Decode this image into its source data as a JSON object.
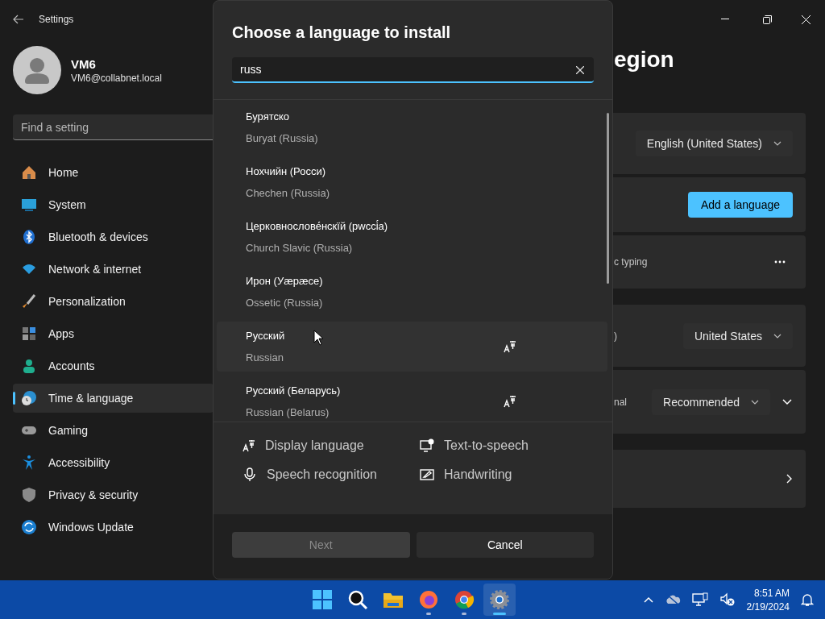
{
  "window": {
    "title": "Settings"
  },
  "account": {
    "name": "VM6",
    "email": "VM6@collabnet.local"
  },
  "search": {
    "placeholder": "Find a setting"
  },
  "sidebar": {
    "items": [
      {
        "label": "Home",
        "kind": "home",
        "selected": false
      },
      {
        "label": "System",
        "kind": "system",
        "selected": false
      },
      {
        "label": "Bluetooth & devices",
        "kind": "bluetooth",
        "selected": false
      },
      {
        "label": "Network & internet",
        "kind": "network",
        "selected": false
      },
      {
        "label": "Personalization",
        "kind": "brush",
        "selected": false
      },
      {
        "label": "Apps",
        "kind": "apps",
        "selected": false
      },
      {
        "label": "Accounts",
        "kind": "accounts",
        "selected": false
      },
      {
        "label": "Time & language",
        "kind": "time",
        "selected": true
      },
      {
        "label": "Gaming",
        "kind": "gaming",
        "selected": false
      },
      {
        "label": "Accessibility",
        "kind": "accessibility",
        "selected": false
      },
      {
        "label": "Privacy & security",
        "kind": "shield",
        "selected": false
      },
      {
        "label": "Windows Update",
        "kind": "update",
        "selected": false
      }
    ]
  },
  "page": {
    "title": "egion",
    "groups": [
      [
        {
          "kind": "dropdown",
          "value": "English (United States)"
        },
        {
          "kind": "button",
          "label": "Add a language"
        },
        {
          "kind": "more",
          "text": "c typing"
        }
      ],
      [
        {
          "kind": "dropdown",
          "text": ")",
          "value": "United States"
        },
        {
          "kind": "dropdown_expand",
          "text": "nal",
          "value": "Recommended"
        }
      ],
      [
        {
          "kind": "link"
        }
      ]
    ]
  },
  "dialog": {
    "title": "Choose a language to install",
    "search": {
      "value": "russ"
    },
    "languages": [
      {
        "native": "Бурятско",
        "english": "Buryat (Russia)",
        "display_language": false,
        "selected": false
      },
      {
        "native": "Нохчийн (Росси)",
        "english": "Chechen (Russia)",
        "display_language": false,
        "selected": false
      },
      {
        "native": "Церковнослове́нскїй (рwссі́а)",
        "english": "Church Slavic (Russia)",
        "display_language": false,
        "selected": false
      },
      {
        "native": "Ирон (Уæрæсе)",
        "english": "Ossetic (Russia)",
        "display_language": false,
        "selected": false
      },
      {
        "native": "Русский",
        "english": "Russian",
        "display_language": true,
        "selected": true
      },
      {
        "native": "Русский (Беларусь)",
        "english": "Russian (Belarus)",
        "display_language": true,
        "selected": false
      }
    ],
    "features": [
      {
        "kind": "display",
        "label": "Display language"
      },
      {
        "kind": "tts",
        "label": "Text-to-speech"
      },
      {
        "kind": "speech",
        "label": "Speech recognition"
      },
      {
        "kind": "handwriting",
        "label": "Handwriting"
      }
    ],
    "buttons": [
      {
        "label": "Next",
        "disabled": true
      },
      {
        "label": "Cancel",
        "disabled": false
      }
    ]
  },
  "taskbar": {
    "apps": [
      {
        "kind": "start",
        "running": false,
        "selected": false
      },
      {
        "kind": "search",
        "running": false,
        "selected": false
      },
      {
        "kind": "explorer",
        "running": false,
        "selected": false
      },
      {
        "kind": "firefox",
        "running": true,
        "selected": false
      },
      {
        "kind": "chrome",
        "running": true,
        "selected": false
      },
      {
        "kind": "settings",
        "running": true,
        "selected": true
      }
    ],
    "time": "8:51 AM",
    "date": "2/19/2024"
  }
}
